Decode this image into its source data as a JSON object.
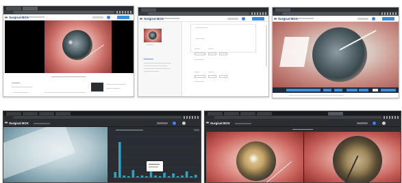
{
  "brand": {
    "logo_text": "Surgical BOX",
    "accent": "#3b8de0",
    "dark_bg": "#1f2124",
    "help_color": "#3b82f6"
  },
  "screenshots": [
    {
      "id": "s1",
      "theme": "light",
      "has_primary_button": true
    },
    {
      "id": "s2",
      "theme": "light",
      "has_primary_button": true
    },
    {
      "id": "s3",
      "theme": "light",
      "has_primary_button": true
    },
    {
      "id": "s4",
      "theme": "dark",
      "has_primary_button": false,
      "chart_title": ""
    },
    {
      "id": "s5",
      "theme": "dark",
      "has_primary_button": false
    }
  ],
  "chart_data": {
    "type": "bar",
    "title": "",
    "categories": [
      "1",
      "2",
      "3",
      "4",
      "5",
      "6",
      "7",
      "8",
      "9",
      "10",
      "11",
      "12",
      "13",
      "14",
      "15",
      "16",
      "17",
      "18",
      "19"
    ],
    "values": [
      8,
      52,
      3,
      2,
      11,
      2,
      3,
      2,
      9,
      3,
      2,
      7,
      2,
      6,
      2,
      3,
      9,
      2,
      4
    ],
    "ylim": [
      0,
      60
    ],
    "color": "#2aa6c8",
    "grid": true
  }
}
